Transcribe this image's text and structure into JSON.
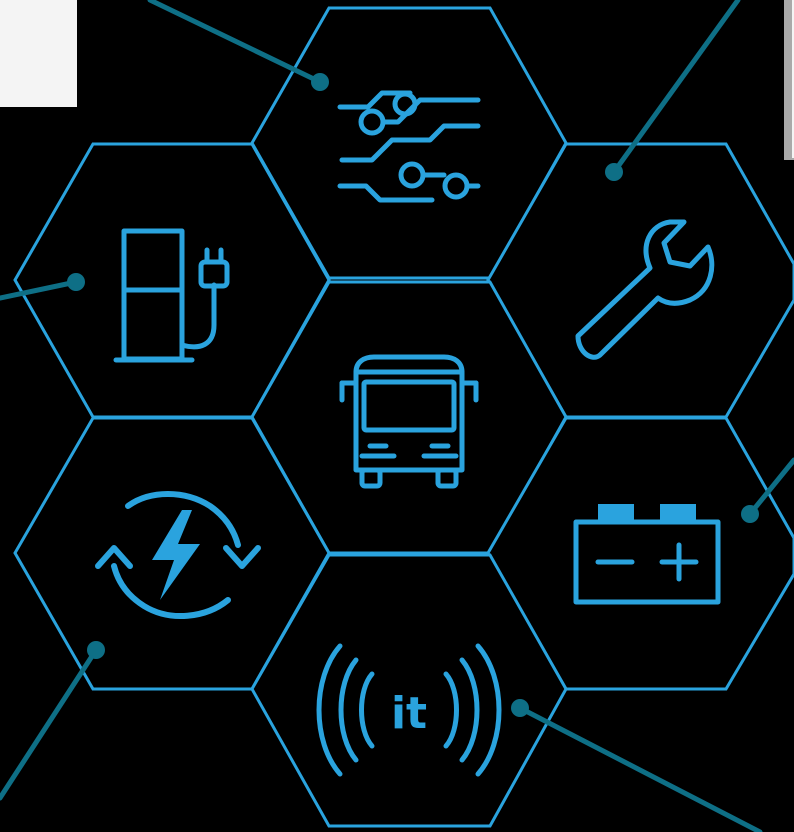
{
  "diagram": {
    "center": {
      "label_icon": "bus-icon"
    },
    "hexagons": [
      {
        "id": "top",
        "icon": "circuit-icon"
      },
      {
        "id": "upper-left",
        "icon": "charging-station-icon"
      },
      {
        "id": "upper-right",
        "icon": "wrench-icon"
      },
      {
        "id": "center",
        "icon": "bus-icon"
      },
      {
        "id": "lower-left",
        "icon": "energy-recycle-icon"
      },
      {
        "id": "lower-right",
        "icon": "battery-icon"
      },
      {
        "id": "bottom",
        "icon": "wireless-it-icon"
      }
    ],
    "it_label": "it",
    "battery_minus": "−",
    "battery_plus": "+",
    "colors": {
      "background": "#000000",
      "outline": "#2aa3de",
      "connector": "#0e6f86"
    }
  }
}
